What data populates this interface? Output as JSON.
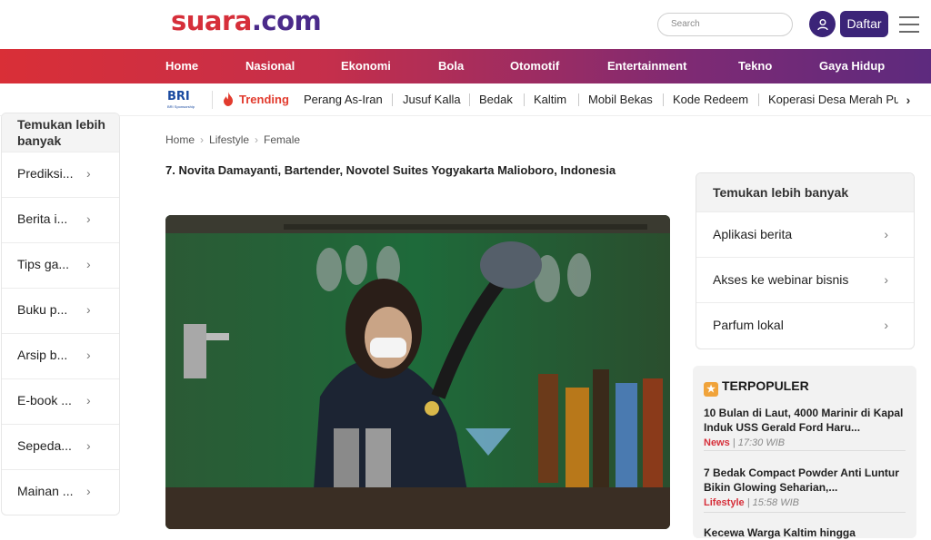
{
  "header": {
    "logo_main": "suara",
    "logo_suffix": ".com",
    "search_placeholder": "Search",
    "register_label": "Daftar",
    "icons": {
      "user": "user-icon",
      "menu": "hamburger-menu-icon"
    }
  },
  "nav": {
    "items": [
      "Home",
      "Nasional",
      "Ekonomi",
      "Bola",
      "Otomotif",
      "Entertainment",
      "Tekno",
      "Gaya Hidup"
    ]
  },
  "trending": {
    "sponsor": "BRI",
    "sponsor_sub": "BRI Sponsorship",
    "label": "Trending",
    "items": [
      "Perang As-Iran",
      "Jusuf Kalla",
      "Bedak",
      "Kaltim",
      "Mobil Bekas",
      "Kode Redeem",
      "Koperasi Desa Merah Putih"
    ],
    "more_icon": "chevron-right-icon"
  },
  "left_sidebar": {
    "heading": "Temukan lebih banyak",
    "items": [
      "Prediksi...",
      "Berita i...",
      "Tips ga...",
      "Buku p...",
      "Arsip b...",
      "E-book ...",
      "Sepeda...",
      "Mainan ..."
    ]
  },
  "article": {
    "breadcrumb": [
      "Home",
      "Lifestyle",
      "Female"
    ],
    "title": "7. Novita Damayanti, Bartender, Novotel Suites Yogyakarta Malioboro, Indonesia"
  },
  "right_sidebar": {
    "heading": "Temukan lebih banyak",
    "items": [
      "Aplikasi berita",
      "Akses ke webinar bisnis",
      "Parfum lokal"
    ]
  },
  "popular": {
    "heading": "TERPOPULER",
    "items": [
      {
        "title": "10 Bulan di Laut, 4000 Marinir di Kapal Induk USS Gerald Ford Haru...",
        "category": "News",
        "time": "17:30 WIB"
      },
      {
        "title": "7 Bedak Compact Powder Anti Luntur Bikin Glowing Seharian,...",
        "category": "Lifestyle",
        "time": "15:58 WIB"
      },
      {
        "title": "Kecewa Warga Kaltim hingga",
        "category": "",
        "time": ""
      }
    ]
  },
  "colors": {
    "brand_red": "#d62f3a",
    "brand_purple": "#3b2478"
  }
}
